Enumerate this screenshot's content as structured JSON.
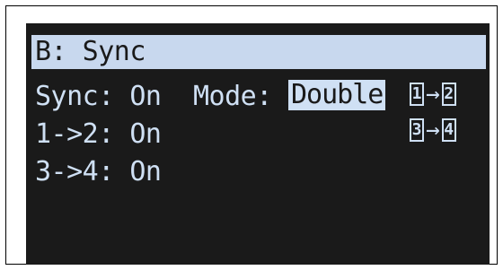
{
  "screen": {
    "title": "B: Sync",
    "rows": [
      {
        "text": "Sync: On"
      },
      {
        "text": "1->2: On"
      },
      {
        "text": "3->4: On"
      }
    ],
    "mode": {
      "label": "Mode:",
      "value": "Double"
    },
    "routing": [
      {
        "from": "1",
        "arrow": "→",
        "to": "2"
      },
      {
        "from": "3",
        "arrow": "→",
        "to": "4"
      }
    ]
  },
  "colors": {
    "screen_background": "#1a1a1a",
    "text": "#cfe0f4",
    "title_highlight": "#c8d8ee"
  }
}
